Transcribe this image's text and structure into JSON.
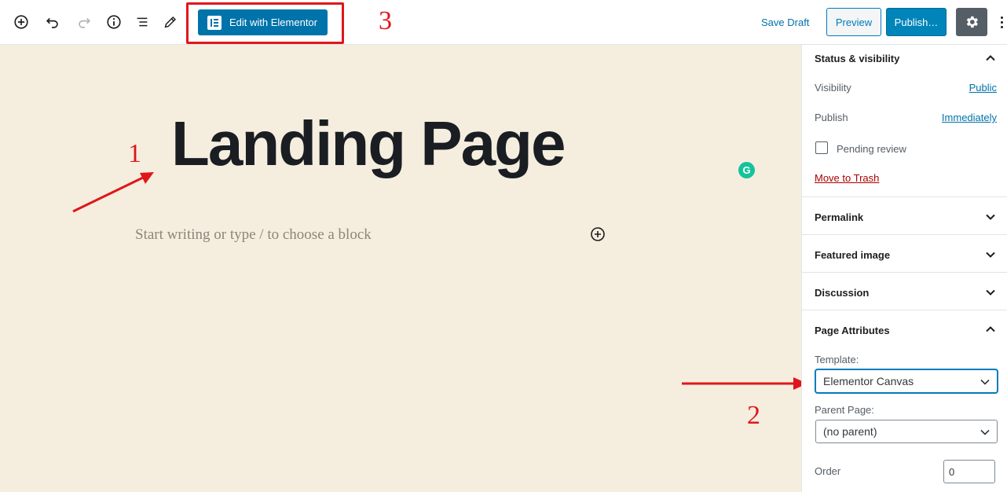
{
  "toolbar": {
    "elementor_label": "Edit with Elementor",
    "save_draft_label": "Save Draft",
    "preview_label": "Preview",
    "publish_label": "Publish…"
  },
  "editor": {
    "page_title": "Landing Page",
    "placeholder": "Start writing or type / to choose a block"
  },
  "annotations": {
    "one": "1",
    "two": "2",
    "three": "3"
  },
  "sidebar": {
    "status_visibility": {
      "title": "Status & visibility",
      "visibility_label": "Visibility",
      "visibility_value": "Public",
      "publish_label": "Publish",
      "publish_value": "Immediately",
      "pending_review_label": "Pending review",
      "trash_label": "Move to Trash"
    },
    "permalink_title": "Permalink",
    "featured_image_title": "Featured image",
    "discussion_title": "Discussion",
    "page_attributes": {
      "title": "Page Attributes",
      "template_label": "Template:",
      "template_value": "Elementor Canvas",
      "parent_label": "Parent Page:",
      "parent_value": "(no parent)",
      "order_label": "Order",
      "order_value": "0"
    }
  },
  "colors": {
    "accent": "#0073aa",
    "canvas_bg": "#f5eedf",
    "annotation_red": "#e0161b"
  }
}
